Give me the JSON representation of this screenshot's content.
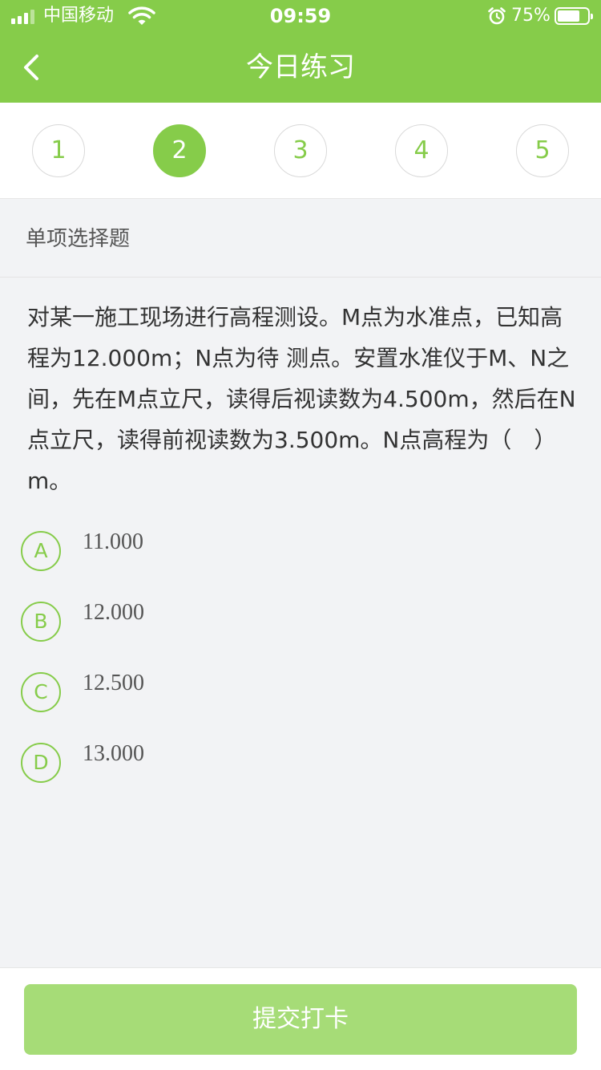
{
  "status_bar": {
    "carrier": "中国移动",
    "time": "09:59",
    "battery_percent": "75%",
    "battery_level": 0.75,
    "signal_bars": 3,
    "signal_bars_total": 4,
    "icons": [
      "signal-icon",
      "wifi-icon",
      "alarm-icon",
      "battery-icon"
    ]
  },
  "nav": {
    "title": "今日练习",
    "back_icon": "chevron-left-icon"
  },
  "steps": {
    "items": [
      "1",
      "2",
      "3",
      "4",
      "5"
    ],
    "active_index": 1
  },
  "question_type": "单项选择题",
  "question": {
    "text": "对某一施工现场进行高程测设。M点为水准点，已知高程为12.000m；N点为待 测点。安置水准仪于M、N之间，先在M点立尺，读得后视读数为4.500m，然后在N 点立尺，读得前视读数为3.500m。N点高程为（　）m。"
  },
  "options": [
    {
      "letter": "A",
      "value": "11.000"
    },
    {
      "letter": "B",
      "value": "12.000"
    },
    {
      "letter": "C",
      "value": "12.500"
    },
    {
      "letter": "D",
      "value": "13.000"
    }
  ],
  "submit_label": "提交打卡",
  "colors": {
    "brand_green": "#86cc4a",
    "submit_disabled": "#a6dc77",
    "background": "#f2f3f5"
  }
}
